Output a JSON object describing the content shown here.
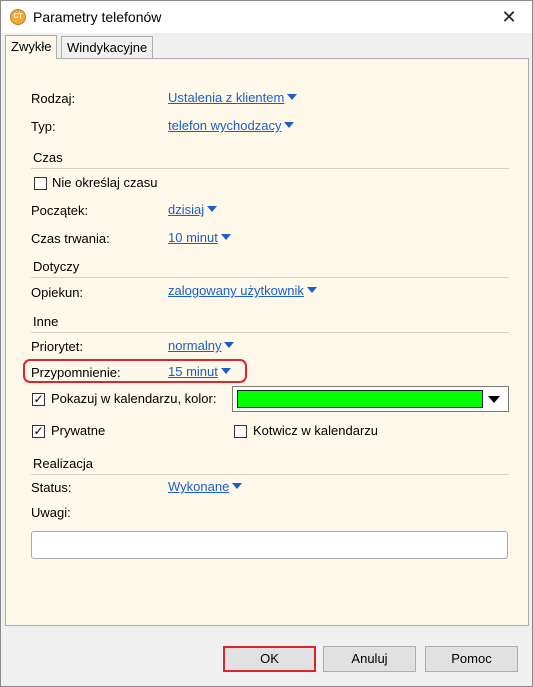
{
  "window": {
    "title": "Parametry telefonów",
    "close_glyph": "✕",
    "icon_text": "CT"
  },
  "tabs": [
    {
      "label": "Zwykłe",
      "active": true
    },
    {
      "label": "Windykacyjne",
      "active": false
    }
  ],
  "fields": {
    "rodzaj": {
      "label": "Rodzaj:",
      "value": "Ustalenia z klientem"
    },
    "typ": {
      "label": "Typ:",
      "value": "telefon wychodzacy"
    }
  },
  "sections": {
    "czas": "Czas",
    "dotyczy": "Dotyczy",
    "inne": "Inne",
    "realizacja": "Realizacja"
  },
  "czas": {
    "nie_okreslaj": {
      "label": "Nie określaj czasu",
      "checked": false
    },
    "poczatek": {
      "label": "Początek:",
      "value": "dzisiaj"
    },
    "czas_trwania": {
      "label": "Czas trwania:",
      "value": "10 minut"
    }
  },
  "dotyczy": {
    "opiekun": {
      "label": "Opiekun:",
      "value": "zalogowany użytkownik"
    }
  },
  "inne": {
    "priorytet": {
      "label": "Priorytet:",
      "value": "normalny"
    },
    "przypomnienie": {
      "label": "Przypomnienie:",
      "value": "15 minut"
    },
    "pokazuj": {
      "label": "Pokazuj w kalendarzu, kolor:",
      "checked": true,
      "check_glyph": "✓"
    },
    "kolor": "#00ff00",
    "prywatne": {
      "label": "Prywatne",
      "checked": true,
      "check_glyph": "✓"
    },
    "kotwicz": {
      "label": "Kotwicz w kalendarzu",
      "checked": false
    }
  },
  "realizacja": {
    "status": {
      "label": "Status:",
      "value": "Wykonane"
    },
    "uwagi": {
      "label": "Uwagi:",
      "value": ""
    }
  },
  "buttons": {
    "ok": "OK",
    "anuluj": "Anuluj",
    "pomoc": "Pomoc"
  },
  "colors": {
    "highlight": "#d9262f",
    "link": "#1a5fc7",
    "panel": "#fdf8ea"
  }
}
